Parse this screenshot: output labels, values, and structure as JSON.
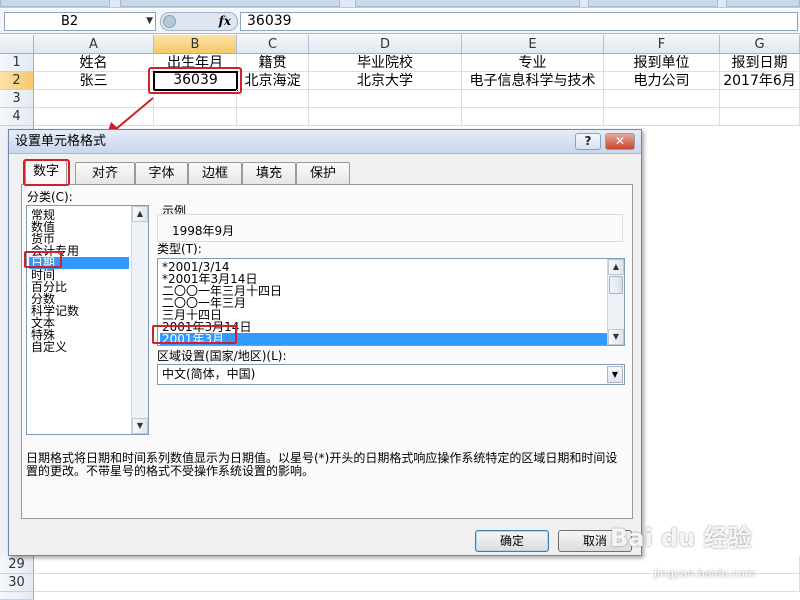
{
  "formula_bar": {
    "name_box": "B2",
    "fx_label": "fx",
    "value": "36039"
  },
  "sheet": {
    "columns": [
      "A",
      "B",
      "C",
      "D",
      "E",
      "F",
      "G"
    ],
    "rows": [
      "1",
      "2",
      "3",
      "4",
      "29",
      "30"
    ],
    "header_row": [
      "姓名",
      "出生年月",
      "籍贯",
      "毕业院校",
      "专业",
      "报到单位",
      "报到日期"
    ],
    "data_row": [
      "张三",
      "36039",
      "北京海淀",
      "北京大学",
      "电子信息科学与技术",
      "电力公司",
      "2017年6月"
    ],
    "active_cell": "B2"
  },
  "dialog": {
    "title": "设置单元格格式",
    "help_label": "?",
    "close_label": "✕",
    "tabs": [
      "数字",
      "对齐",
      "字体",
      "边框",
      "填充",
      "保护"
    ],
    "active_tab": "数字",
    "category_label": "分类(C):",
    "categories": [
      "常规",
      "数值",
      "货币",
      "会计专用",
      "日期",
      "时间",
      "百分比",
      "分数",
      "科学记数",
      "文本",
      "特殊",
      "自定义"
    ],
    "selected_category": "日期",
    "sample_label": "示例",
    "sample_value": "1998年9月",
    "type_label": "类型(T):",
    "types": [
      "*2001/3/14",
      "*2001年3月14日",
      "二〇〇一年三月十四日",
      "二〇〇一年三月",
      "三月十四日",
      "2001年3月14日",
      "2001年3月"
    ],
    "selected_type": "2001年3月",
    "locale_label": "区域设置(国家/地区)(L):",
    "locale_value": "中文(简体，中国)",
    "description": "日期格式将日期和时间系列数值显示为日期值。以星号(*)开头的日期格式响应操作系统特定的区域日期和时间设置的更改。不带星号的格式不受操作系统设置的影响。",
    "ok_label": "确定",
    "cancel_label": "取消"
  },
  "watermark": {
    "brand": "Bai du 经验",
    "url": "jingyan.baidu.com"
  },
  "colors": {
    "highlight": "#d0202a",
    "selection": "#3399ff",
    "header_selected": "#f5c86a"
  }
}
